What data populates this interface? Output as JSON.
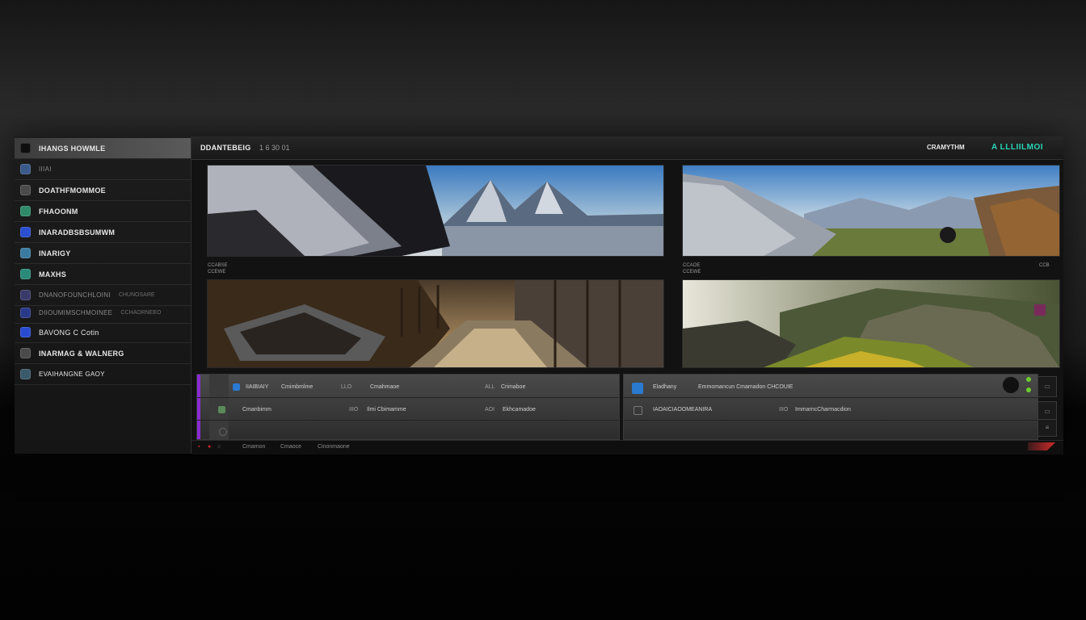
{
  "header": {
    "title": "DDANTEBEIG",
    "title_num": "1 6 30 01",
    "right_label": "CRAMYTHM",
    "right_value": "A LLLIILMOI"
  },
  "sidebar": {
    "items": [
      {
        "label": "IHANGS HOWMLE",
        "color": "#2a2a2a"
      },
      {
        "label": "IIIAI",
        "color": "#3a5a8a"
      },
      {
        "label": "DOATHFMOMMOE",
        "color": "#4a4a4a"
      },
      {
        "label": "FHAOONM",
        "color": "#2f8a6a"
      },
      {
        "label": "INARADBSBSUMWM",
        "color": "#2a4fd0"
      },
      {
        "label": "INARIGY",
        "color": "#3a7aa0"
      },
      {
        "label": "MAXHS",
        "color": "#2a8a7a"
      },
      {
        "label": "DNANOFOUNCHLOINI",
        "sub": "CHUNOSARE",
        "color": "#3a3a6a"
      },
      {
        "label": "DIIOUMIMSCHMOINEE",
        "sub": "CCHAORNEEO",
        "color": "#2a3a8a"
      },
      {
        "label": "BAVONG C Cotin",
        "color": "#2a4ad0"
      },
      {
        "label": "INARMAG & WALNERG",
        "color": "#4a4a4a"
      },
      {
        "label": "EVAIHANGNE  GAOY",
        "color": "#3a5a6a"
      }
    ]
  },
  "panels": {
    "top_left_caption": [
      "CCABSE",
      "CCEWE"
    ],
    "top_right_caption": [
      "CCAOE",
      "CCEWE"
    ],
    "right_caption_tag": "CCB"
  },
  "list_left": {
    "rows": [
      [
        "IIAIBIAIY",
        "Cmimbmlme",
        "LLO",
        "Cmahmaoe",
        "ALL",
        "Crimaboe"
      ],
      [
        "Cmanbimm",
        "IIIO",
        "Ilmi Cbimamme",
        "AOI",
        "Ekhcamadoe"
      ]
    ]
  },
  "list_right": {
    "rows": [
      [
        "Eladhany",
        "Emmomancun  Cmamadon CHCOUIE"
      ],
      [
        "IAOAICIAOOMEANIRA",
        "IIIO",
        "ImmarncCharmacdion"
      ]
    ]
  },
  "footer": {
    "items": [
      "Cmamon",
      "Cmaoce",
      "Cinonmaone"
    ]
  },
  "colors": {
    "accent_teal": "#29d6b8",
    "accent_purple": "#8a2ad0",
    "accent_red": "#d02a2a",
    "accent_green": "#6ad02a"
  }
}
